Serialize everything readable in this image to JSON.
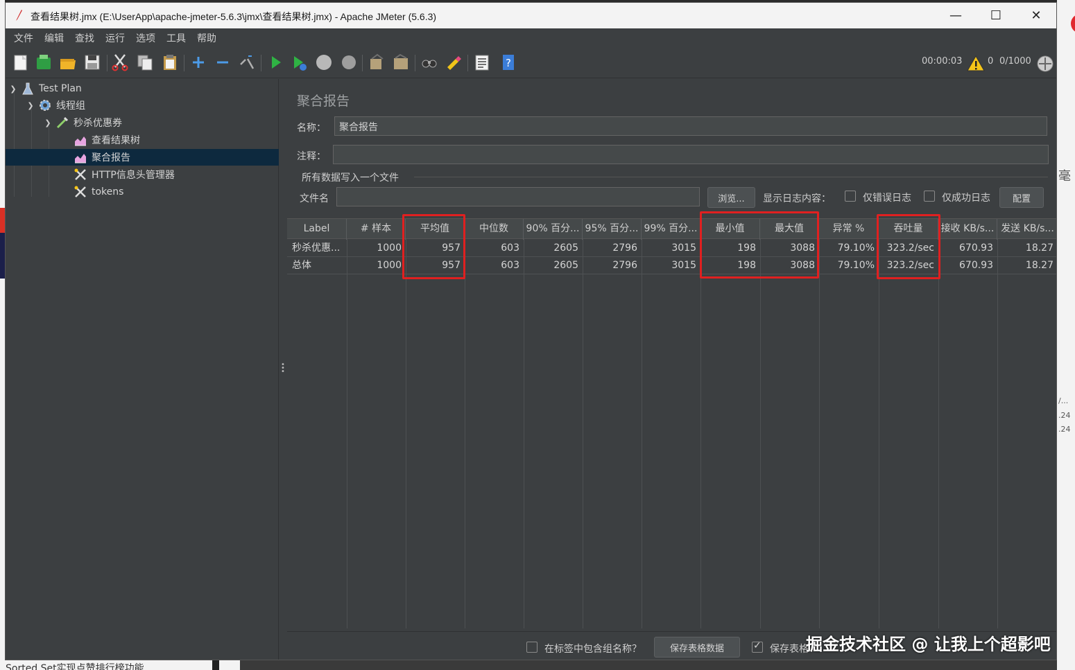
{
  "window": {
    "title": "查看结果树.jmx (E:\\UserApp\\apache-jmeter-5.6.3\\jmx\\查看结果树.jmx) - Apache JMeter (5.6.3)",
    "minimize": "—",
    "maximize": "☐",
    "close": "✕"
  },
  "menu": [
    "文件",
    "编辑",
    "查找",
    "运行",
    "选项",
    "工具",
    "帮助"
  ],
  "toolbar": {
    "elapsed": "00:00:03",
    "warnings": "0",
    "threads": "0/1000"
  },
  "tree": {
    "items": [
      {
        "label": "Test Plan",
        "icon": "flask-icon"
      },
      {
        "label": "线程组",
        "icon": "gear-icon"
      },
      {
        "label": "秒杀优惠券",
        "icon": "pipette-icon"
      },
      {
        "label": "查看结果树",
        "icon": "chart-icon"
      },
      {
        "label": "聚合报告",
        "icon": "chart-icon"
      },
      {
        "label": "HTTP信息头管理器",
        "icon": "tools-icon"
      },
      {
        "label": "tokens",
        "icon": "tools-icon"
      }
    ]
  },
  "panel": {
    "title": "聚合报告",
    "name_label": "名称：",
    "name_value": "聚合报告",
    "comment_label": "注释：",
    "comment_value": "",
    "group_label": "所有数据写入一个文件",
    "file_label": "文件名",
    "file_value": "",
    "browse": "浏览...",
    "log_label": "显示日志内容：",
    "errors_only": "仅错误日志",
    "success_only": "仅成功日志",
    "configure": "配置"
  },
  "table": {
    "headers": [
      "Label",
      "# 样本",
      "平均值",
      "中位数",
      "90% 百分...",
      "95% 百分...",
      "99% 百分...",
      "最小值",
      "最大值",
      "异常 %",
      "吞吐量",
      "接收 KB/s...",
      "发送 KB/s..."
    ],
    "rows": [
      [
        "秒杀优惠...",
        "1000",
        "957",
        "603",
        "2605",
        "2796",
        "3015",
        "198",
        "3088",
        "79.10%",
        "323.2/sec",
        "670.93",
        "18.27"
      ],
      [
        "总体",
        "1000",
        "957",
        "603",
        "2605",
        "2796",
        "3015",
        "198",
        "3088",
        "79.10%",
        "323.2/sec",
        "670.93",
        "18.27"
      ]
    ]
  },
  "bottom": {
    "include_group": "在标签中包含组名称？",
    "save_table": "保存表格数据",
    "save_header": "保存表格"
  },
  "background": {
    "left_bottom_text": "Sorted Set实现点赞排行榜功能",
    "right_snips": [
      "毫",
      "/...",
      ".24",
      ".24"
    ]
  },
  "watermark": "掘金技术社区 @ 让我上个超影吧",
  "colors": {
    "highlight": "#e02020",
    "selection": "#0d293e",
    "panel": "#3c3f41"
  }
}
